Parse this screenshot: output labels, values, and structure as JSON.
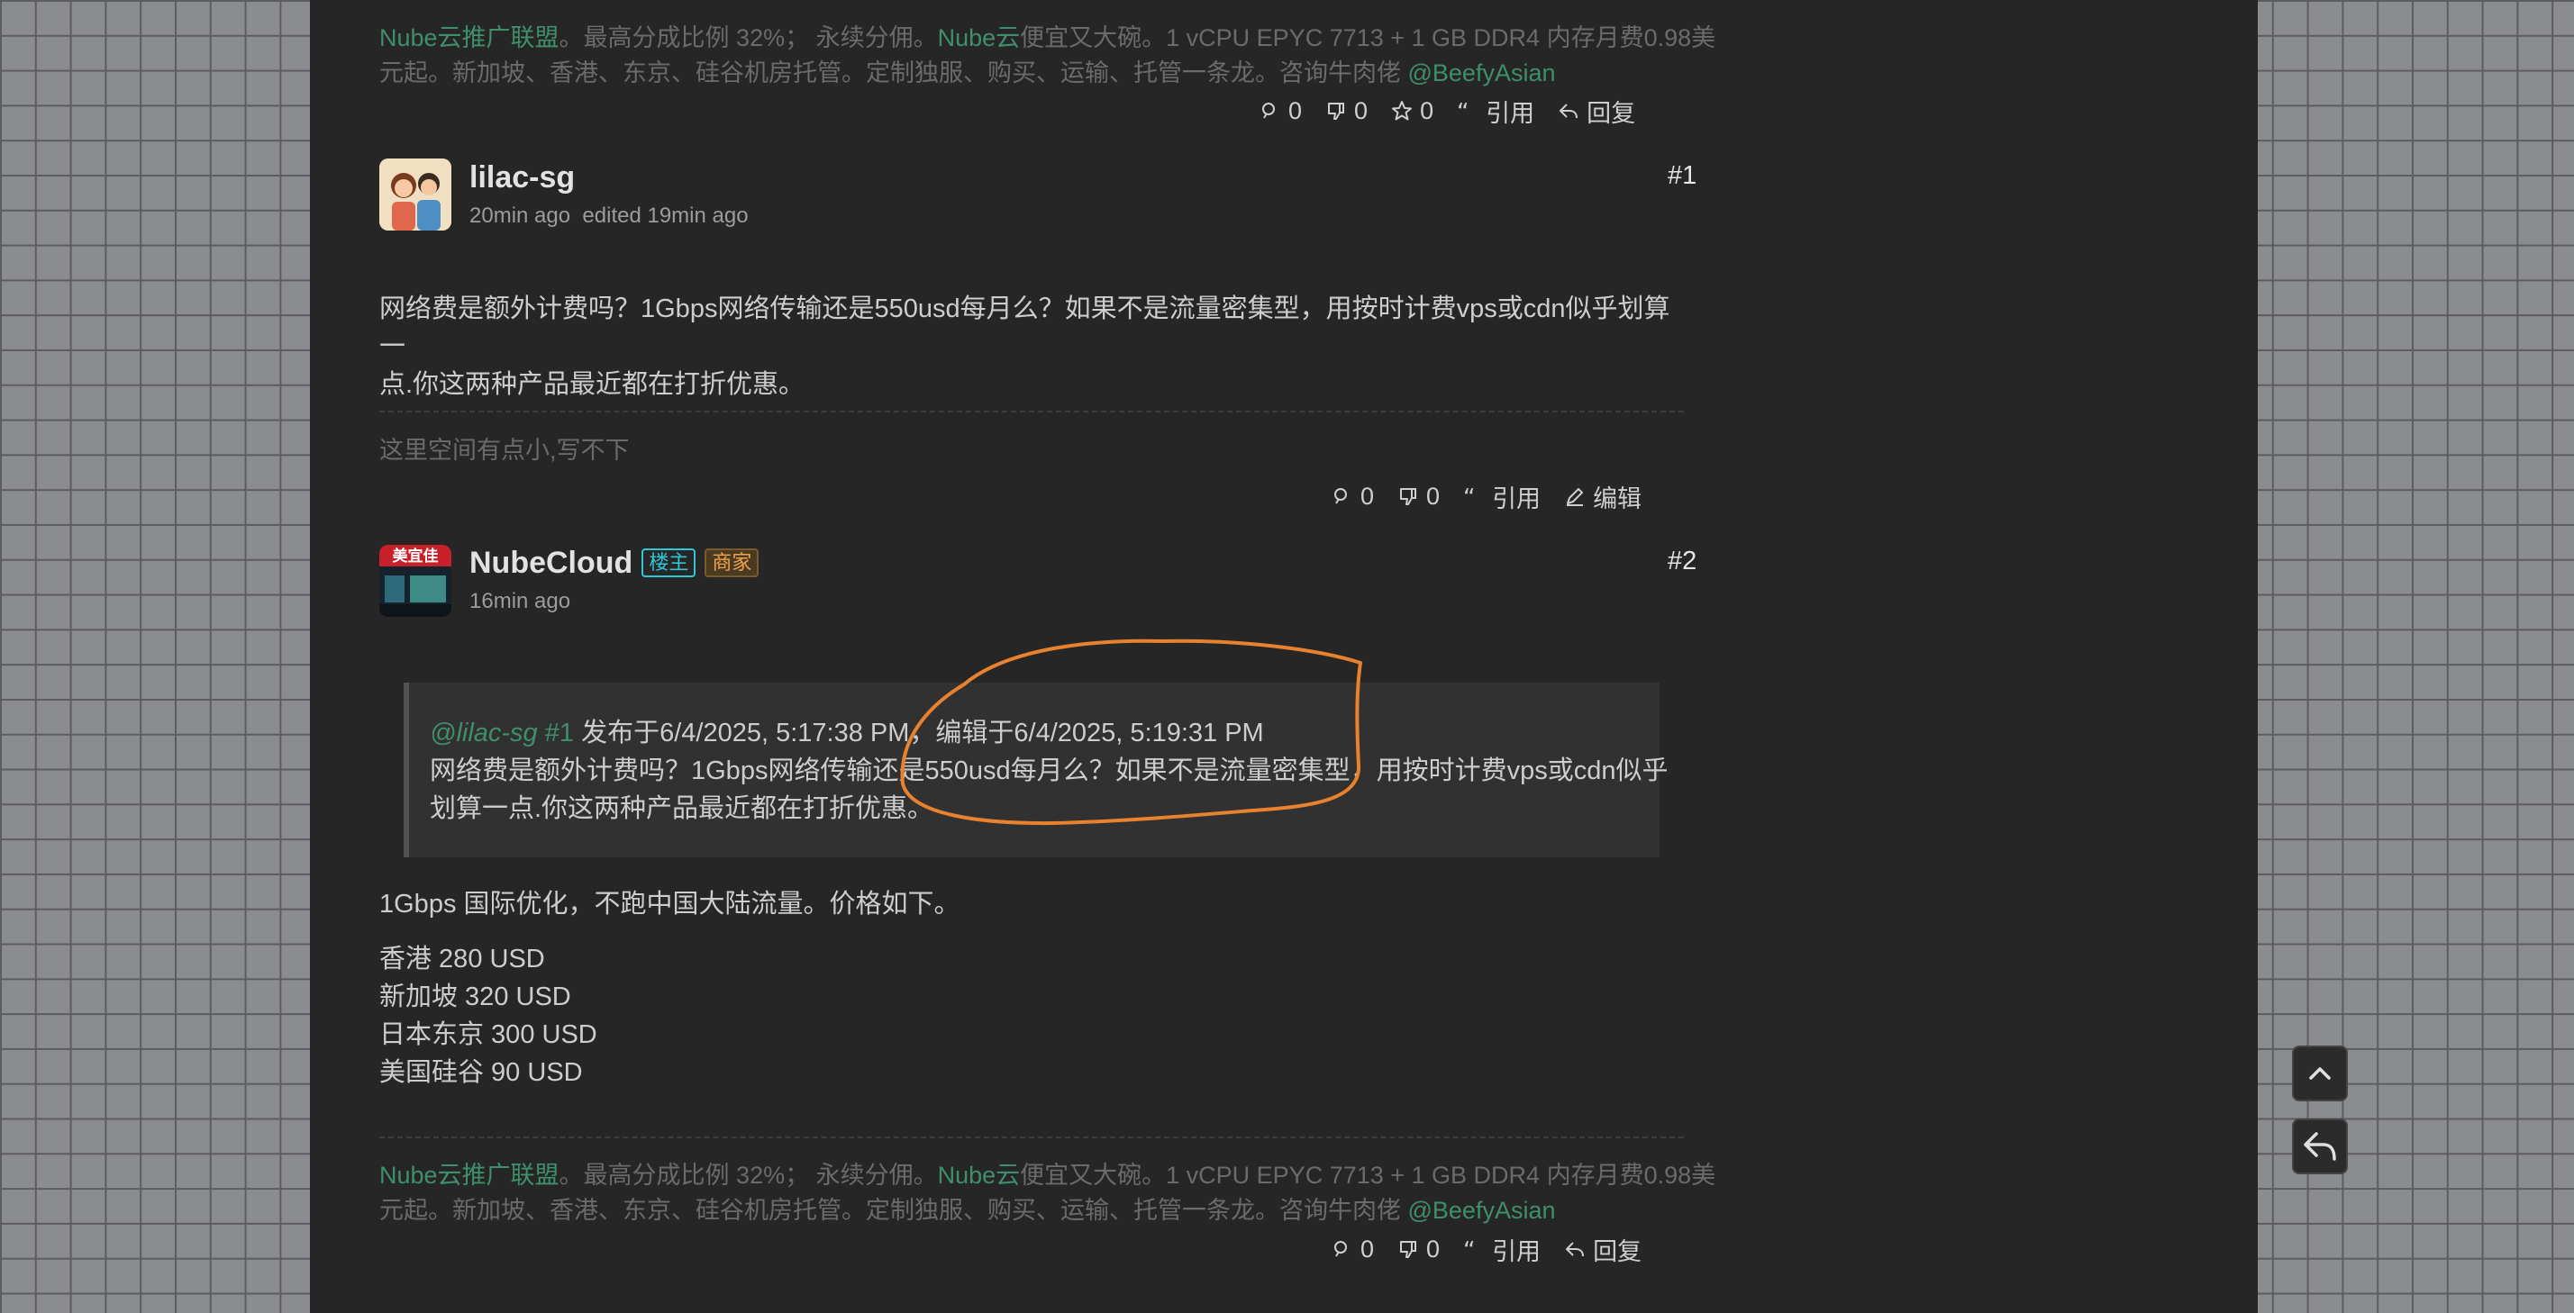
{
  "signature": {
    "line1": {
      "aff": "Nube云推广联盟",
      "mid": "。最高分成比例 32%； 永续分佣。",
      "brand": "Nube云",
      "rest": "便宜又大碗。1 vCPU EPYC 7713 + 1 GB DDR4 内存月费0.98美"
    },
    "line2": {
      "text": "元起。新加坡、香港、东京、硅谷机房托管。定制独服、购买、运输、托管一条龙。咨询牛肉佬 ",
      "handle": "@BeefyAsian"
    }
  },
  "top_actions": {
    "views": "0",
    "dislikes": "0",
    "stars": "0",
    "quote": "引用",
    "reply": "回复"
  },
  "post1": {
    "username": "lilac-sg",
    "time": "20min ago",
    "edited": "edited 19min ago",
    "floor": "#1",
    "line1": "网络费是额外计费吗？1Gbps网络传输还是550usd每月么？如果不是流量密集型，用按时计费vps或cdn似乎划算一",
    "line2": "点.你这两种产品最近都在打折优惠。",
    "signature": "这里空间有点小,写不下",
    "actions": {
      "views": "0",
      "dislikes": "0",
      "quote": "引用",
      "edit": "编辑"
    }
  },
  "post2": {
    "username": "NubeCloud",
    "badge_op": "楼主",
    "badge_merchant": "商家",
    "time": "16min ago",
    "floor": "#2",
    "avatar_text": "美宜佳",
    "quote": {
      "mention": "@lilac-sg",
      "ref": "#1",
      "meta": "发布于6/4/2025, 5:17:38 PM，编辑于6/4/2025, 5:19:31 PM",
      "line1": "网络费是额外计费吗？1Gbps网络传输还是550usd每月么？如果不是流量密集型，用按时计费vps或cdn似乎",
      "line2": "划算一点.你这两种产品最近都在打折优惠。"
    },
    "intro": "1Gbps 国际优化，不跑中国大陆流量。价格如下。",
    "prices": [
      "香港 280 USD",
      "新加坡 320 USD",
      "日本东京 300 USD",
      "美国硅谷 90 USD"
    ],
    "actions": {
      "views": "0",
      "dislikes": "0",
      "quote": "引用",
      "reply": "回复"
    }
  },
  "colors": {
    "annotation": "#e8822e",
    "link_green": "#3f8f6c",
    "op_badge": "#2dc7d6",
    "merchant_badge": "#f0a24a"
  }
}
